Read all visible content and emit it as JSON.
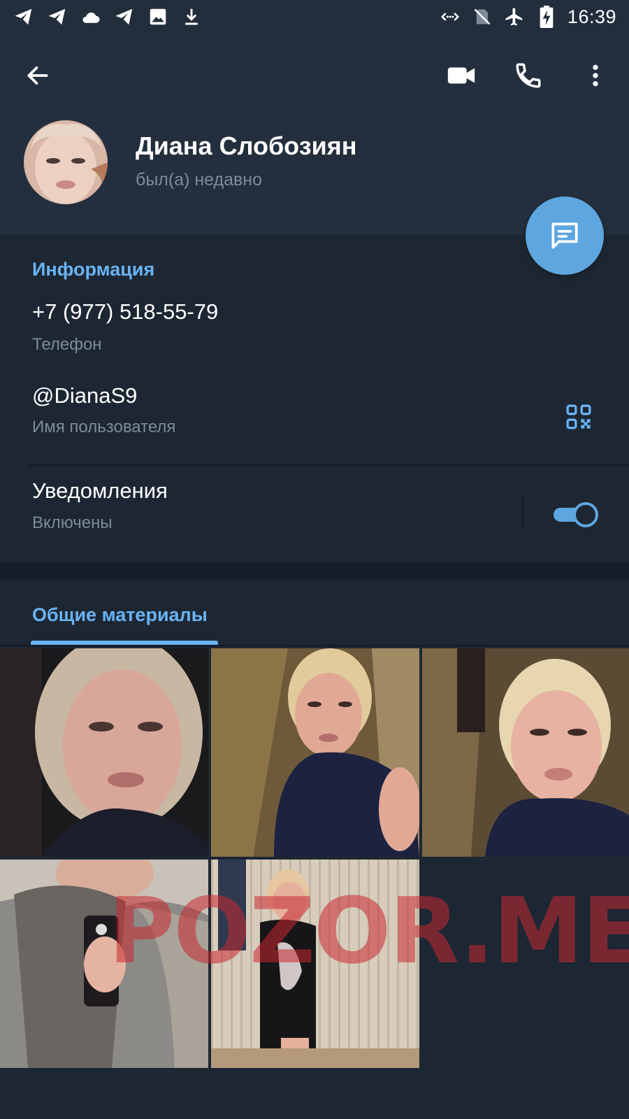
{
  "status_bar": {
    "time": "16:39",
    "left_icons": [
      "telegram-icon",
      "telegram-icon",
      "cloud-icon",
      "telegram-icon",
      "image-icon",
      "download-icon"
    ],
    "right_icons": [
      "code-icon",
      "no-sim-icon",
      "airplane-icon",
      "battery-charging-icon"
    ]
  },
  "header": {
    "back_icon": "arrow-left-icon",
    "actions": [
      "video-call-icon",
      "phone-icon",
      "more-vert-icon"
    ]
  },
  "profile": {
    "name": "Диана Слобозиян",
    "status": "был(а) недавно"
  },
  "fab_icon": "message-icon",
  "info": {
    "title": "Информация",
    "phone": {
      "value": "+7 (977) 518-55-79",
      "label": "Телефон"
    },
    "username": {
      "value": "@DianaS9",
      "label": "Имя пользователя"
    },
    "notifications": {
      "value": "Уведомления",
      "label": "Включены",
      "enabled": true
    }
  },
  "media": {
    "tab_label": "Общие материалы",
    "photo_count": 5
  },
  "watermark": "POZOR.ME",
  "colors": {
    "accent": "#6ab3f3",
    "fab": "#5ea6e0",
    "background": "#1d2733",
    "header": "#232f3e",
    "muted_text": "#7f8b99"
  }
}
